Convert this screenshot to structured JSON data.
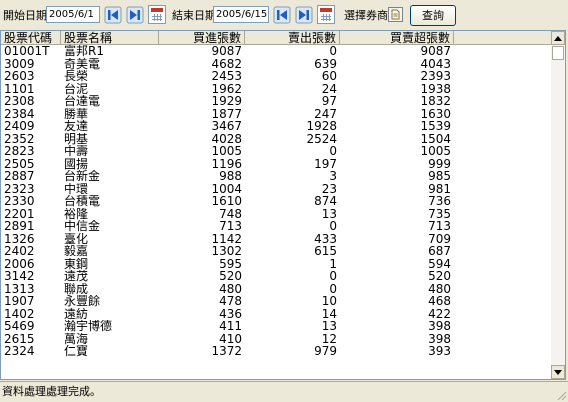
{
  "toolbar": {
    "start_label": "開始日期",
    "start_date": "2005/6/1",
    "end_label": "結束日期",
    "end_date": "2005/6/15",
    "broker_label": "選擇券商",
    "query_label": "查詢"
  },
  "icons": {
    "prev": "prev-arrow-icon",
    "next": "next-arrow-icon",
    "calendar": "calendar-icon",
    "broker_picker": "document-icon"
  },
  "colors": {
    "nav_arrow": "#1f5fbf",
    "calendar_header": "#c0392b",
    "window_bg": "#ece9d8",
    "border": "#7f9db9"
  },
  "table": {
    "columns": [
      "股票代碼",
      "股票名稱",
      "買進張數",
      "賣出張數",
      "買賣超張數"
    ],
    "rows": [
      [
        "01001T",
        "富邦R1",
        "9087",
        "0",
        "9087"
      ],
      [
        "3009",
        "奇美電",
        "4682",
        "639",
        "4043"
      ],
      [
        "2603",
        "長榮",
        "2453",
        "60",
        "2393"
      ],
      [
        "1101",
        "台泥",
        "1962",
        "24",
        "1938"
      ],
      [
        "2308",
        "台達電",
        "1929",
        "97",
        "1832"
      ],
      [
        "2384",
        "勝華",
        "1877",
        "247",
        "1630"
      ],
      [
        "2409",
        "友達",
        "3467",
        "1928",
        "1539"
      ],
      [
        "2352",
        "明基",
        "4028",
        "2524",
        "1504"
      ],
      [
        "2823",
        "中壽",
        "1005",
        "0",
        "1005"
      ],
      [
        "2505",
        "國揚",
        "1196",
        "197",
        "999"
      ],
      [
        "2887",
        "台新金",
        "988",
        "3",
        "985"
      ],
      [
        "2323",
        "中環",
        "1004",
        "23",
        "981"
      ],
      [
        "2330",
        "台積電",
        "1610",
        "874",
        "736"
      ],
      [
        "2201",
        "裕隆",
        "748",
        "13",
        "735"
      ],
      [
        "2891",
        "中信金",
        "713",
        "0",
        "713"
      ],
      [
        "1326",
        "臺化",
        "1142",
        "433",
        "709"
      ],
      [
        "2402",
        "毅嘉",
        "1302",
        "615",
        "687"
      ],
      [
        "2006",
        "東鋼",
        "595",
        "1",
        "594"
      ],
      [
        "3142",
        "遠茂",
        "520",
        "0",
        "520"
      ],
      [
        "1313",
        "聯成",
        "480",
        "0",
        "480"
      ],
      [
        "1907",
        "永豐餘",
        "478",
        "10",
        "468"
      ],
      [
        "1402",
        "遠紡",
        "436",
        "14",
        "422"
      ],
      [
        "5469",
        "瀚宇博德",
        "411",
        "13",
        "398"
      ],
      [
        "2615",
        "萬海",
        "410",
        "12",
        "398"
      ],
      [
        "2324",
        "仁寶",
        "1372",
        "979",
        "393"
      ]
    ]
  },
  "status": {
    "message": "資料處理處理完成。"
  }
}
